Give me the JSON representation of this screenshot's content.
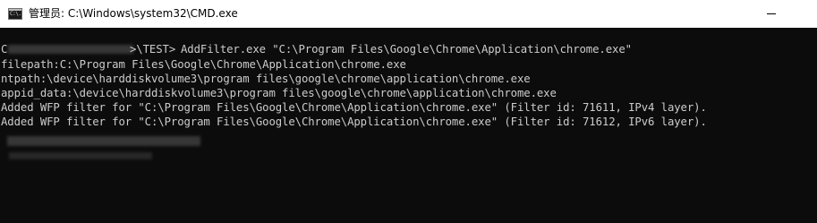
{
  "window": {
    "title": "管理员: C:\\Windows\\system32\\CMD.exe",
    "app_icon_label": "C:\\."
  },
  "console": {
    "prompt_suffix": ">\\TEST>",
    "command": "AddFilter.exe \"C:\\Program Files\\Google\\Chrome\\Application\\chrome.exe\"",
    "output_lines": [
      "filepath:C:\\Program Files\\Google\\Chrome\\Application\\chrome.exe",
      "ntpath:\\device\\harddiskvolume3\\program files\\google\\chrome\\application\\chrome.exe",
      "appid_data:\\device\\harddiskvolume3\\program files\\google\\chrome\\application\\chrome.exe",
      "Added WFP filter for \"C:\\Program Files\\Google\\Chrome\\Application\\chrome.exe\" (Filter id: 71611, IPv4 layer).",
      "Added WFP filter for \"C:\\Program Files\\Google\\Chrome\\Application\\chrome.exe\" (Filter id: 71612, IPv6 layer)."
    ],
    "leading_char": "C"
  },
  "colors": {
    "console_background": "#0c0c0c",
    "console_text": "#cccccc",
    "titlebar_background": "#ffffff",
    "titlebar_text": "#000000"
  }
}
